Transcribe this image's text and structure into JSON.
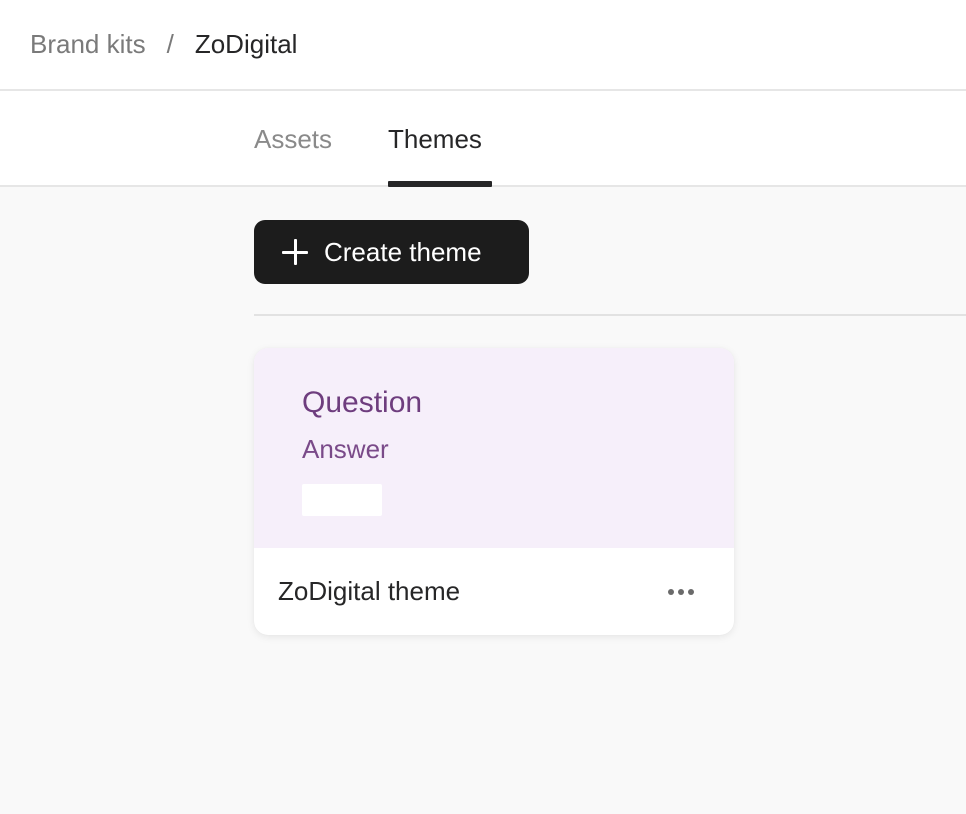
{
  "breadcrumb": {
    "parent": "Brand kits",
    "separator": "/",
    "current": "ZoDigital"
  },
  "tabs": [
    {
      "label": "Assets",
      "active": false
    },
    {
      "label": "Themes",
      "active": true
    }
  ],
  "toolbar": {
    "create_label": "Create theme",
    "create_icon": "plus-icon"
  },
  "themes": [
    {
      "name": "ZoDigital theme",
      "preview": {
        "question": "Question",
        "answer": "Answer",
        "background": "#f6effa",
        "text_color": "#6e3d7e"
      },
      "menu_icon": "more-horizontal-icon"
    }
  ],
  "colors": {
    "primary_button": "#1c1c1c",
    "active_tab_underline": "#262627"
  }
}
